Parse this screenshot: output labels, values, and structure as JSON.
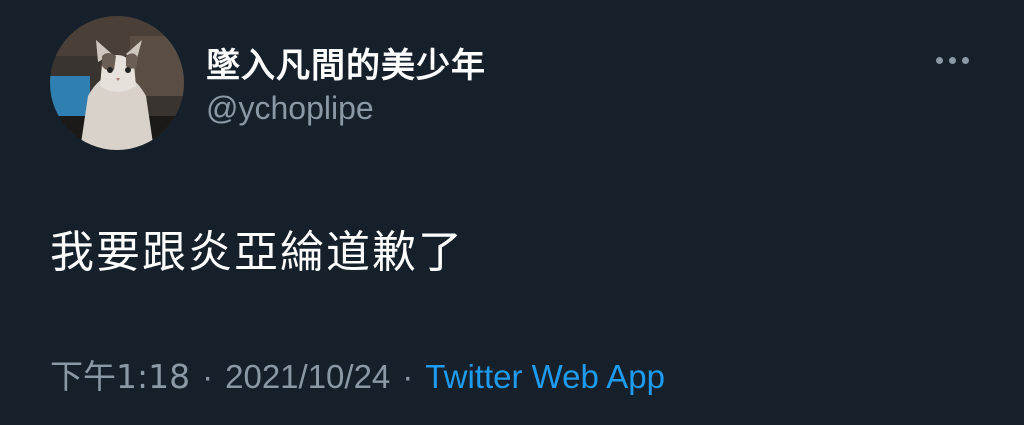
{
  "author": {
    "display_name": "墜入凡間的美少年",
    "handle": "@ychoplipe",
    "avatar_icon": "cat-avatar-icon"
  },
  "more_icon": "more-horizontal-icon",
  "tweet": {
    "text": "我要跟炎亞綸道歉了",
    "time": "下午1:18",
    "separator": "·",
    "date": "2021/10/24",
    "source": "Twitter Web App"
  },
  "colors": {
    "background": "#15202b",
    "text_primary": "#ffffff",
    "text_secondary": "#8b98a5",
    "accent": "#1d9bf0"
  }
}
